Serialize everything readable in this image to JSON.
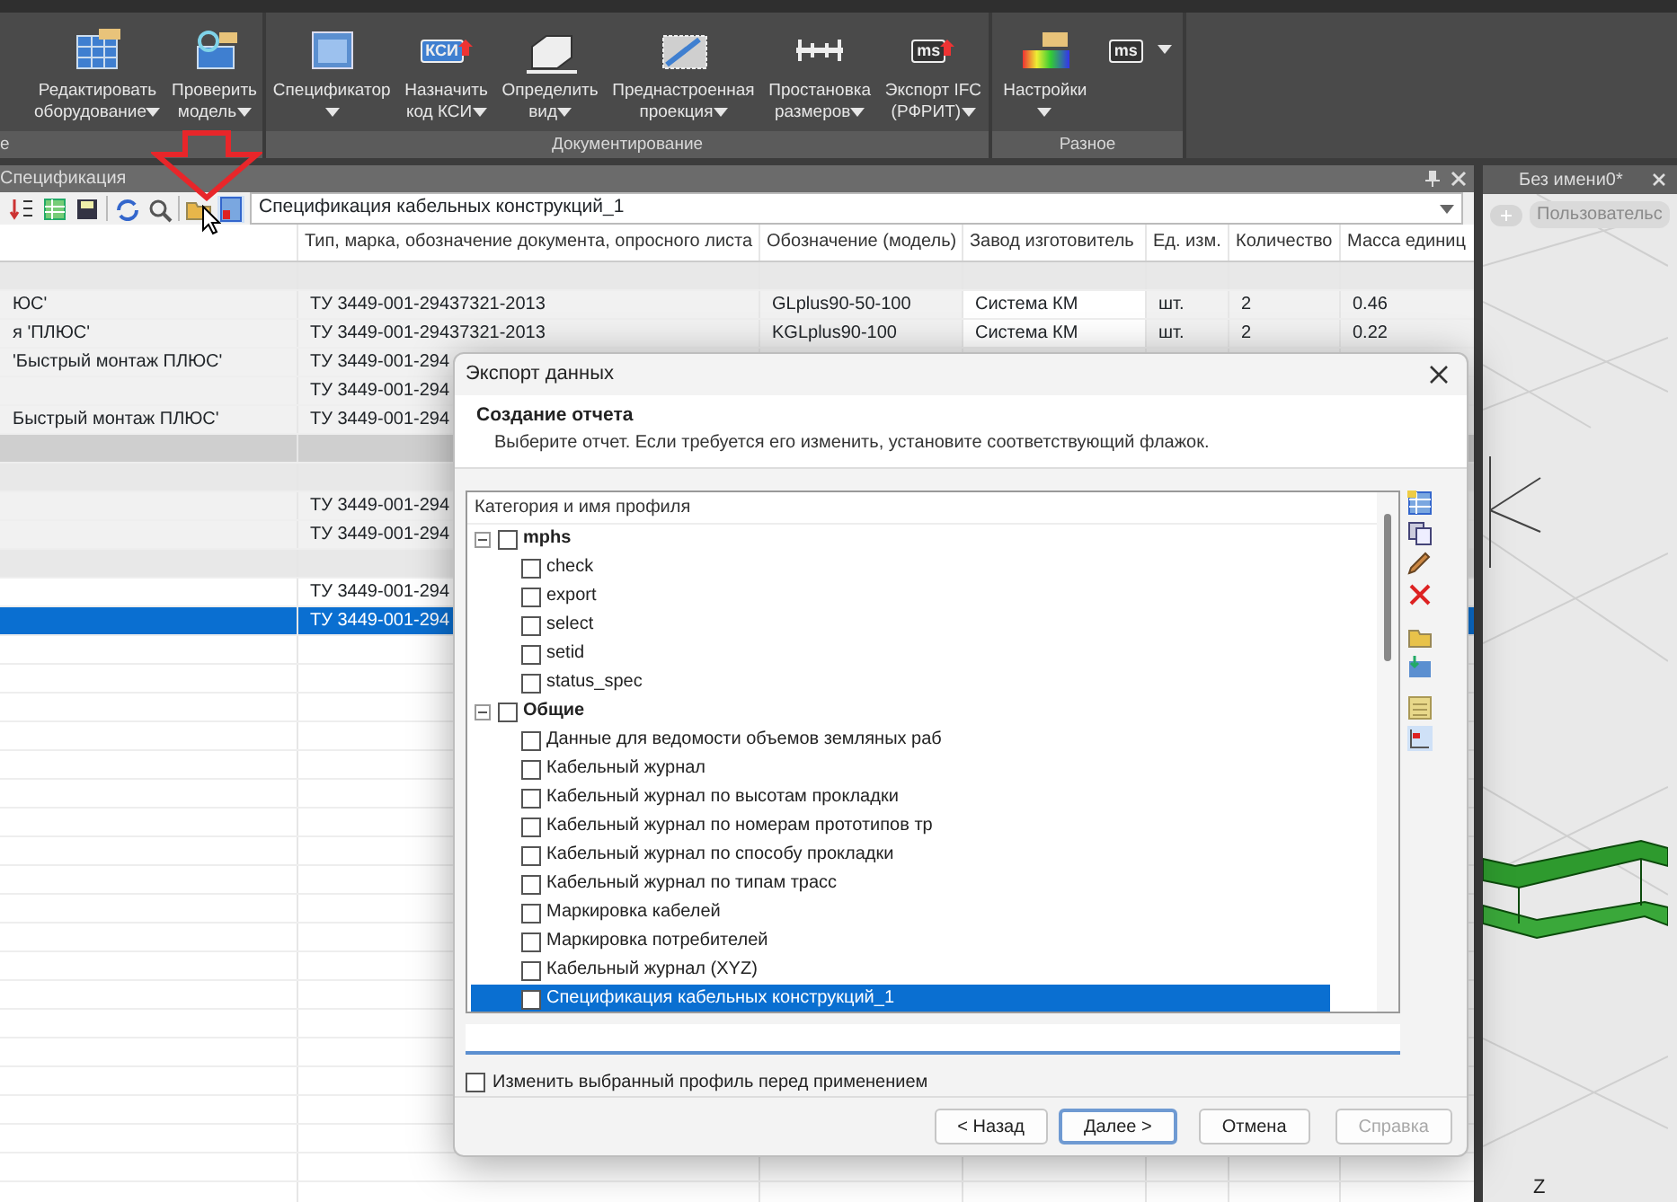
{
  "ribbon": {
    "groups": [
      {
        "label": "е",
        "buttons": [
          {
            "lines": [
              "Редактировать",
              "оборудование"
            ],
            "dropdown": true
          },
          {
            "lines": [
              "Проверить",
              "модель"
            ],
            "dropdown": true
          }
        ]
      },
      {
        "label": "Документирование",
        "buttons": [
          {
            "lines": [
              "Спецификатор"
            ],
            "dropdown": true
          },
          {
            "lines": [
              "Назначить",
              "код КСИ"
            ],
            "dropdown": true,
            "icon_text": "КСИ"
          },
          {
            "lines": [
              "Определить",
              "вид"
            ],
            "dropdown": true
          },
          {
            "lines": [
              "Преднастроенная",
              "проекция"
            ],
            "dropdown": true
          },
          {
            "lines": [
              "Простановка",
              "размеров"
            ],
            "dropdown": true
          },
          {
            "lines": [
              "Экспорт IFC",
              "(РФРИТ)"
            ],
            "dropdown": true,
            "icon_text": "ms"
          }
        ]
      },
      {
        "label": "Разное",
        "buttons": [
          {
            "lines": [
              "Настройки"
            ],
            "dropdown": true
          },
          {
            "dropdown": true,
            "icon_text": "ms"
          }
        ]
      }
    ]
  },
  "spec_panel": {
    "title": "Спецификация",
    "profile": "Спецификация кабельных конструкций_1",
    "columns": [
      "Тип, марка, обозначение документа, опросного листа",
      "Обозначение (модель)",
      "Завод изготовитель",
      "Ед. изм.",
      "Количество",
      "Масса единиц"
    ],
    "rows": [
      {
        "kind": "group",
        "selected": false,
        "cells": {}
      },
      {
        "kind": "item",
        "selected": false,
        "cells": {
          "column_1": "ЮС'",
          "type_mark": "ТУ 3449-001-29437321-2013",
          "designation": "GLplus90-50-100",
          "manufacturer": "Система КМ",
          "unit": "шт.",
          "quantity": "2",
          "unit_mass": "0.46"
        }
      },
      {
        "kind": "item",
        "selected": false,
        "cells": {
          "column_1": "я 'ПЛЮС'",
          "type_mark": "ТУ 3449-001-29437321-2013",
          "designation": "KGLplus90-100",
          "manufacturer": "Система КМ",
          "unit": "шт.",
          "quantity": "2",
          "unit_mass": "0.22"
        }
      },
      {
        "kind": "item",
        "selected": false,
        "cells": {
          "column_1": "'Быстрый монтаж ПЛЮС'",
          "type_mark": "ТУ 3449-001-294"
        }
      },
      {
        "kind": "item",
        "selected": false,
        "cells": {
          "type_mark": "ТУ 3449-001-294"
        }
      },
      {
        "kind": "item",
        "selected": false,
        "cells": {
          "column_1": "Быстрый монтаж ПЛЮС'",
          "type_mark": "ТУ 3449-001-294"
        }
      },
      {
        "kind": "section",
        "selected": false,
        "cells": {}
      },
      {
        "kind": "group",
        "selected": false,
        "cells": {}
      },
      {
        "kind": "item",
        "selected": false,
        "cells": {
          "type_mark": "ТУ 3449-001-294"
        }
      },
      {
        "kind": "item",
        "selected": false,
        "cells": {
          "type_mark": "ТУ 3449-001-294"
        }
      },
      {
        "kind": "group",
        "selected": false,
        "cells": {}
      },
      {
        "kind": "plain",
        "selected": false,
        "cells": {
          "type_mark": "ТУ 3449-001-294"
        }
      },
      {
        "kind": "plain",
        "selected": true,
        "cells": {
          "type_mark": "ТУ 3449-001-294"
        }
      }
    ]
  },
  "viewport": {
    "tab": "Без имени0*",
    "view_mode": "Пользовательс",
    "axis_label": "Z"
  },
  "dialog": {
    "title": "Экспорт данных",
    "heading": "Создание отчета",
    "subtitle": "Выберите отчет. Если требуется его изменить, установите соответствующий флажок.",
    "tree_header": "Категория и имя профиля",
    "groups": [
      {
        "label": "mphs",
        "expanded": true,
        "checked": false,
        "children": [
          {
            "label": "check",
            "checked": false,
            "selected": false
          },
          {
            "label": "export",
            "checked": false,
            "selected": false
          },
          {
            "label": "select",
            "checked": false,
            "selected": false
          },
          {
            "label": "setid",
            "checked": false,
            "selected": false
          },
          {
            "label": "status_spec",
            "checked": false,
            "selected": false
          }
        ]
      },
      {
        "label": "Общие",
        "expanded": true,
        "checked": false,
        "children": [
          {
            "label": "Данные для ведомости объемов земляных раб",
            "checked": false,
            "selected": false
          },
          {
            "label": "Кабельный журнал",
            "checked": false,
            "selected": false
          },
          {
            "label": "Кабельный журнал по высотам прокладки",
            "checked": false,
            "selected": false
          },
          {
            "label": "Кабельный журнал по номерам прототипов тр",
            "checked": false,
            "selected": false
          },
          {
            "label": "Кабельный журнал по способу прокладки",
            "checked": false,
            "selected": false
          },
          {
            "label": "Кабельный журнал по типам трасс",
            "checked": false,
            "selected": false
          },
          {
            "label": "Маркировка кабелей",
            "checked": false,
            "selected": false
          },
          {
            "label": "Маркировка потребителей",
            "checked": false,
            "selected": false
          },
          {
            "label": "Кабельный журнал (XYZ)",
            "checked": false,
            "selected": false
          },
          {
            "label": "Спецификация кабельных конструкций_1",
            "checked": false,
            "selected": true
          }
        ]
      }
    ],
    "edit_profile": {
      "label": "Изменить выбранный профиль перед применением",
      "checked": false
    },
    "buttons": [
      {
        "label": "< Назад",
        "kind": "normal"
      },
      {
        "label": "Далее >",
        "kind": "default"
      },
      {
        "label": "Отмена",
        "kind": "normal"
      },
      {
        "label": "Справка",
        "kind": "disabled"
      }
    ]
  }
}
